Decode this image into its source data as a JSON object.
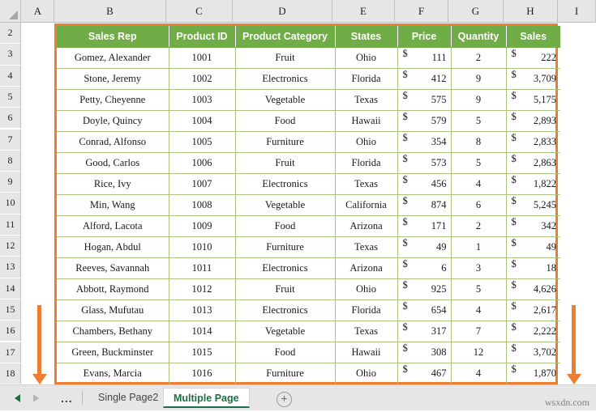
{
  "app": {
    "type": "spreadsheet",
    "accent_orange": "#ED7D31",
    "header_green": "#70AD47",
    "grid_green": "#A9C47F",
    "watermark": "wsxdn.com"
  },
  "grid": {
    "column_letters": [
      "A",
      "B",
      "C",
      "D",
      "E",
      "F",
      "G",
      "H",
      "I"
    ],
    "row_numbers": [
      "2",
      "3",
      "4",
      "5",
      "6",
      "7",
      "8",
      "9",
      "10",
      "11",
      "12",
      "13",
      "14",
      "15",
      "16",
      "17",
      "18"
    ]
  },
  "table": {
    "headers": [
      "Sales Rep",
      "Product ID",
      "Product Category",
      "States",
      "Price",
      "Quantity",
      "Sales"
    ],
    "currency_symbol": "$",
    "rows": [
      {
        "rep": "Gomez, Alexander",
        "id": "1001",
        "category": "Fruit",
        "state": "Ohio",
        "price": "111",
        "qty": "2",
        "sales": "222"
      },
      {
        "rep": "Stone, Jeremy",
        "id": "1002",
        "category": "Electronics",
        "state": "Florida",
        "price": "412",
        "qty": "9",
        "sales": "3,709"
      },
      {
        "rep": "Petty, Cheyenne",
        "id": "1003",
        "category": "Vegetable",
        "state": "Texas",
        "price": "575",
        "qty": "9",
        "sales": "5,175"
      },
      {
        "rep": "Doyle, Quincy",
        "id": "1004",
        "category": "Food",
        "state": "Hawaii",
        "price": "579",
        "qty": "5",
        "sales": "2,893"
      },
      {
        "rep": "Conrad, Alfonso",
        "id": "1005",
        "category": "Furniture",
        "state": "Ohio",
        "price": "354",
        "qty": "8",
        "sales": "2,833"
      },
      {
        "rep": "Good, Carlos",
        "id": "1006",
        "category": "Fruit",
        "state": "Florida",
        "price": "573",
        "qty": "5",
        "sales": "2,863"
      },
      {
        "rep": "Rice, Ivy",
        "id": "1007",
        "category": "Electronics",
        "state": "Texas",
        "price": "456",
        "qty": "4",
        "sales": "1,822"
      },
      {
        "rep": "Min, Wang",
        "id": "1008",
        "category": "Vegetable",
        "state": "California",
        "price": "874",
        "qty": "6",
        "sales": "5,245"
      },
      {
        "rep": "Alford, Lacota",
        "id": "1009",
        "category": "Food",
        "state": "Arizona",
        "price": "171",
        "qty": "2",
        "sales": "342"
      },
      {
        "rep": "Hogan, Abdul",
        "id": "1010",
        "category": "Furniture",
        "state": "Texas",
        "price": "49",
        "qty": "1",
        "sales": "49"
      },
      {
        "rep": "Reeves, Savannah",
        "id": "1011",
        "category": "Electronics",
        "state": "Arizona",
        "price": "6",
        "qty": "3",
        "sales": "18"
      },
      {
        "rep": "Abbott, Raymond",
        "id": "1012",
        "category": "Fruit",
        "state": "Ohio",
        "price": "925",
        "qty": "5",
        "sales": "4,626"
      },
      {
        "rep": "Glass, Mufutau",
        "id": "1013",
        "category": "Electronics",
        "state": "Florida",
        "price": "654",
        "qty": "4",
        "sales": "2,617"
      },
      {
        "rep": "Chambers, Bethany",
        "id": "1014",
        "category": "Vegetable",
        "state": "Texas",
        "price": "317",
        "qty": "7",
        "sales": "2,222"
      },
      {
        "rep": "Green, Buckminster",
        "id": "1015",
        "category": "Food",
        "state": "Hawaii",
        "price": "308",
        "qty": "12",
        "sales": "3,702"
      },
      {
        "rep": "Evans, Marcia",
        "id": "1016",
        "category": "Furniture",
        "state": "Ohio",
        "price": "467",
        "qty": "4",
        "sales": "1,870"
      }
    ]
  },
  "annotations": {
    "left_arrow": "down-arrow",
    "right_arrow": "down-arrow"
  },
  "tabbar": {
    "prev_icon": "triangle-left-icon",
    "next_icon": "triangle-right-icon",
    "ellipsis": "...",
    "tabs": [
      {
        "label": "Single Page2",
        "active": false
      },
      {
        "label": "Multiple Page",
        "active": true
      }
    ],
    "add_sheet_label": "+"
  }
}
